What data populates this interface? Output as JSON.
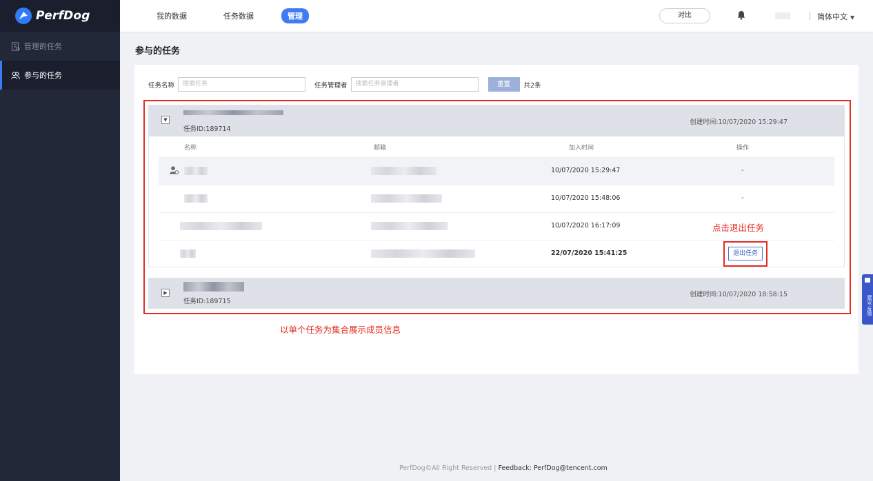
{
  "app": {
    "brand": "PerfDog"
  },
  "sidebar": {
    "items": [
      {
        "label": "管理的任务",
        "icon": "doc-icon",
        "active": false
      },
      {
        "label": "参与的任务",
        "icon": "users-icon",
        "active": true
      }
    ]
  },
  "topbar": {
    "nav": [
      {
        "label": "我的数据",
        "active": false
      },
      {
        "label": "任务数据",
        "active": false
      },
      {
        "label": "管理",
        "active": true
      }
    ],
    "compare_label": "对比",
    "language_label": "简体中文"
  },
  "page": {
    "title": "参与的任务"
  },
  "filters": {
    "task_name_label": "任务名称",
    "task_name_placeholder": "搜索任务",
    "manager_label": "任务管理者",
    "manager_placeholder": "搜索任务管理者",
    "reset_label": "重置",
    "total_text": "共2条"
  },
  "groups": [
    {
      "id_text": "任务ID:189714",
      "created_text": "创建时间:10/07/2020 15:29:47",
      "expanded": true
    },
    {
      "id_text": "任务ID:189715",
      "created_text": "创建时间:10/07/2020 18:58:15",
      "expanded": false
    }
  ],
  "table": {
    "headers": {
      "name": "名称",
      "email": "邮箱",
      "join_time": "加入时间",
      "action": "操作"
    },
    "rows": [
      {
        "join_time": "10/07/2020 15:29:47",
        "action": "-",
        "is_owner": true
      },
      {
        "join_time": "10/07/2020 15:48:06",
        "action": "-",
        "is_owner": false
      },
      {
        "join_time": "10/07/2020 16:17:09",
        "action": "",
        "is_owner": false
      },
      {
        "join_time": "22/07/2020 15:41:25",
        "action": "退出任务",
        "is_owner": false
      }
    ]
  },
  "annotations": {
    "exit_hint": "点击退出任务",
    "group_hint": "以单个任务为集合展示成员信息"
  },
  "float_tab": {
    "label": "建议·反馈"
  },
  "footer": {
    "copyright": "PerfDog©All Right Reserved",
    "feedback": "Feedback: PerfDog@tencent.com"
  },
  "colors": {
    "accent": "#3f7bf5",
    "sidebar_bg": "#232838",
    "annotation_red": "#e52b20"
  }
}
